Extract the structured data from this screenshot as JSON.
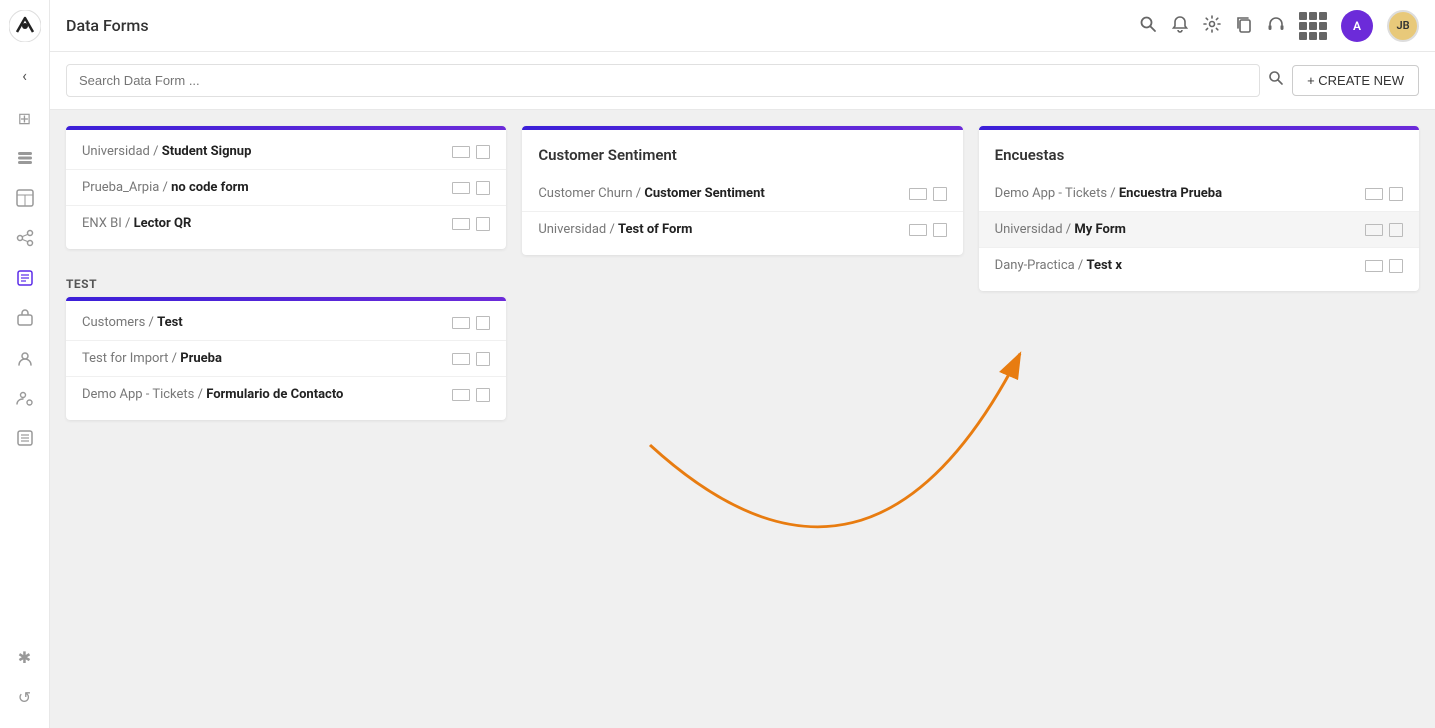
{
  "topbar": {
    "title": "Data Forms"
  },
  "searchbar": {
    "placeholder": "Search Data Form ...",
    "create_label": "+ CREATE NEW"
  },
  "columns": [
    {
      "id": "col1",
      "title": null,
      "sections": [
        {
          "id": "sec-default",
          "label": null,
          "forms": [
            {
              "org": "Universidad",
              "name": "Student Signup"
            },
            {
              "org": "Prueba_Arpia",
              "name": "no code form"
            },
            {
              "org": "ENX BI",
              "name": "Lector QR"
            }
          ]
        },
        {
          "id": "sec-test",
          "label": "TEST",
          "forms": [
            {
              "org": "Customers",
              "name": "Test"
            },
            {
              "org": "Test for Import",
              "name": "Prueba"
            },
            {
              "org": "Demo App - Tickets",
              "name": "Formulario de Contacto"
            }
          ]
        }
      ]
    },
    {
      "id": "col2",
      "title": "Customer Sentiment",
      "sections": [
        {
          "id": "sec-cs",
          "label": null,
          "forms": [
            {
              "org": "Customer Churn",
              "name": "Customer Sentiment"
            },
            {
              "org": "Universidad",
              "name": "Test of Form"
            }
          ]
        }
      ]
    },
    {
      "id": "col3",
      "title": "Encuestas",
      "sections": [
        {
          "id": "sec-enc",
          "label": null,
          "forms": [
            {
              "org": "Demo App - Tickets",
              "name": "Encuestra Prueba"
            },
            {
              "org": "Universidad",
              "name": "My Form"
            },
            {
              "org": "Dany-Practica",
              "name": "Test x"
            }
          ]
        }
      ]
    }
  ],
  "sidebar": {
    "logo_text": "A",
    "nav_back": "‹",
    "icons": [
      {
        "name": "apps-icon",
        "symbol": "⊞",
        "active": false
      },
      {
        "name": "database-icon",
        "symbol": "≡",
        "active": false
      },
      {
        "name": "table-icon",
        "symbol": "⊟",
        "active": false
      },
      {
        "name": "share-icon",
        "symbol": "⌥",
        "active": false
      },
      {
        "name": "form-icon",
        "symbol": "☐",
        "active": true
      },
      {
        "name": "briefcase-icon",
        "symbol": "⊞",
        "active": false
      },
      {
        "name": "user-icon",
        "symbol": "⚇",
        "active": false
      },
      {
        "name": "person-settings-icon",
        "symbol": "⚙",
        "active": false
      },
      {
        "name": "list-icon",
        "symbol": "☰",
        "active": false
      }
    ],
    "bottom_icons": [
      {
        "name": "tools-icon",
        "symbol": "✱"
      },
      {
        "name": "refresh-icon",
        "symbol": "↺"
      }
    ]
  },
  "avatar_purple_text": "A",
  "avatar_photo_text": "JB",
  "arrow": {
    "from_col": 1,
    "from_row": 0,
    "to_col": 2,
    "to_row": 1
  }
}
